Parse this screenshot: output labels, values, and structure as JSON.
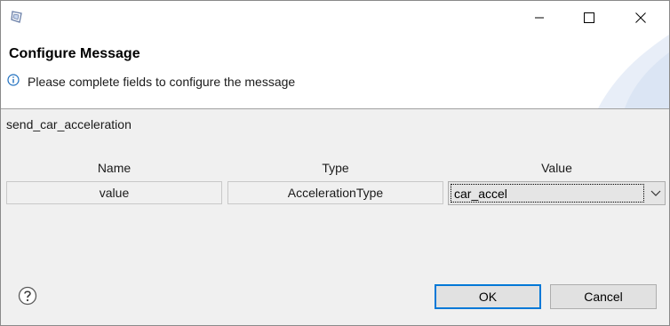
{
  "dialog": {
    "title": "Configure Message",
    "subtitle": "Please complete fields to configure the message"
  },
  "message": {
    "name": "send_car_acceleration"
  },
  "table": {
    "headers": {
      "name": "Name",
      "type": "Type",
      "value": "Value"
    },
    "rows": [
      {
        "name": "value",
        "type": "AccelerationType",
        "value": "car_accel"
      }
    ]
  },
  "buttons": {
    "ok": "OK",
    "cancel": "Cancel"
  },
  "icons": {
    "app": "eclipse-dialog-icon",
    "minimize": "minimize-icon",
    "maximize": "maximize-icon",
    "close": "close-icon",
    "info": "info-icon",
    "help": "help-icon",
    "dropdown": "chevron-down-icon"
  },
  "colors": {
    "accent": "#0078d7",
    "info": "#1f6fbf"
  }
}
